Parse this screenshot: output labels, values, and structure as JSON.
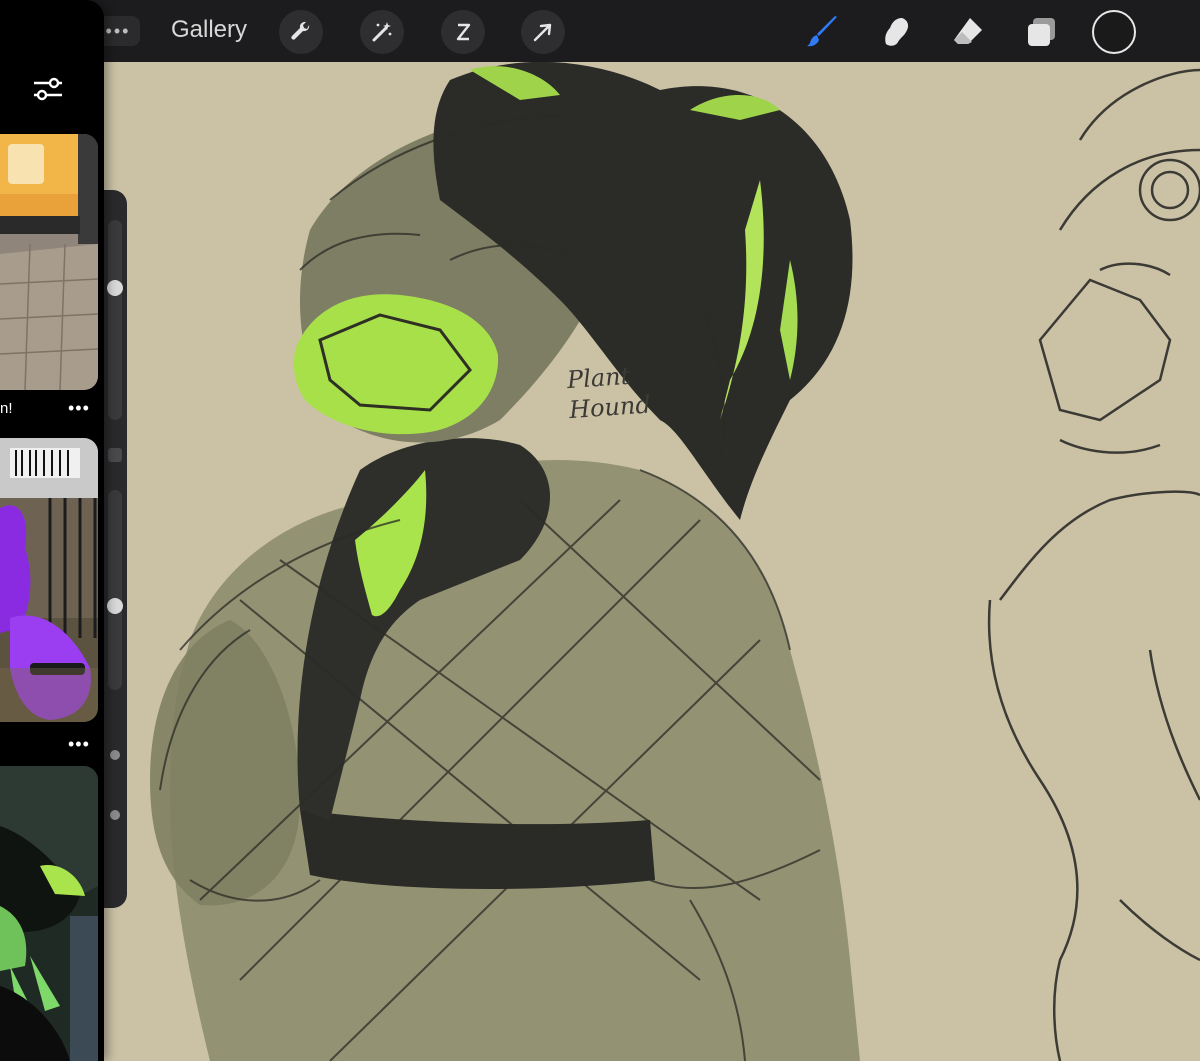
{
  "toolbar": {
    "more_label": "•••",
    "gallery_label": "Gallery",
    "left_tools": [
      "wrench-icon",
      "magic-wand-icon",
      "selection-icon",
      "transform-arrow-icon"
    ],
    "right_tools": [
      "brush-icon",
      "smudge-icon",
      "eraser-icon",
      "layers-icon"
    ],
    "active_tool": "brush-icon",
    "accent_color": "#2f7bf6",
    "current_color": "#1a1a1a"
  },
  "canvas": {
    "background_color": "#cbc2a6",
    "note_text": "Plant\nHound"
  },
  "slideover": {
    "filter_icon": "sliders-icon",
    "posts": [
      {
        "caption": "n!",
        "more": "•••",
        "image": "street-poster-photo"
      },
      {
        "caption": "",
        "more": "•••",
        "image": "purple-costume-photo"
      },
      {
        "caption": "",
        "more": "",
        "image": "green-black-costume-photo"
      }
    ]
  }
}
